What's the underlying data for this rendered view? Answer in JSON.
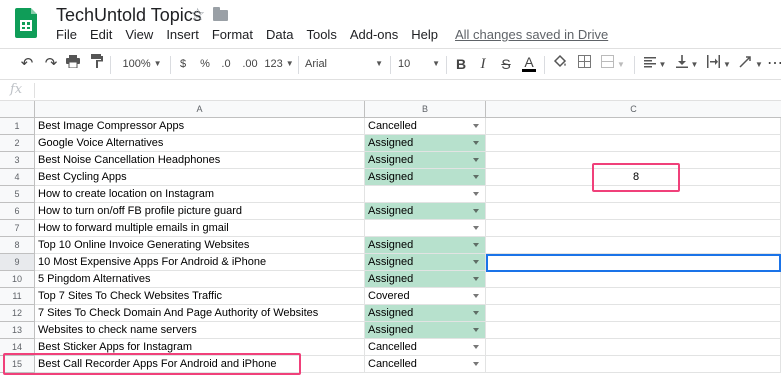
{
  "header": {
    "title": "TechUntold Topics",
    "menu": [
      "File",
      "Edit",
      "View",
      "Insert",
      "Format",
      "Data",
      "Tools",
      "Add-ons",
      "Help"
    ],
    "saved_status": "All changes saved in Drive"
  },
  "toolbar": {
    "zoom": "100%",
    "currency": "$",
    "percent": "%",
    "decimal_decrease": ".0",
    "decimal_increase": ".00",
    "more_formats": "123",
    "font": "Arial",
    "font_size": "10",
    "bold": "B",
    "italic": "I",
    "strikethrough": "S",
    "text_color": "A"
  },
  "formula_bar": {
    "fx": "fx",
    "value": ""
  },
  "columns": [
    "A",
    "B",
    "C"
  ],
  "rows": [
    {
      "num": "1",
      "a": "Best Image Compressor Apps",
      "b": "Cancelled"
    },
    {
      "num": "2",
      "a": "Google Voice Alternatives",
      "b": "Assigned"
    },
    {
      "num": "3",
      "a": "Best Noise Cancellation Headphones",
      "b": "Assigned"
    },
    {
      "num": "4",
      "a": "Best Cycling Apps",
      "b": "Assigned"
    },
    {
      "num": "5",
      "a": "How to create location on Instagram",
      "b": ""
    },
    {
      "num": "6",
      "a": "How to turn on/off FB profile picture guard",
      "b": "Assigned"
    },
    {
      "num": "7",
      "a": "How to forward multiple emails in gmail",
      "b": ""
    },
    {
      "num": "8",
      "a": "Top 10 Online Invoice Generating Websites",
      "b": "Assigned"
    },
    {
      "num": "9",
      "a": "10 Most Expensive Apps For Android & iPhone",
      "b": "Assigned"
    },
    {
      "num": "10",
      "a": "5 Pingdom Alternatives",
      "b": "Assigned"
    },
    {
      "num": "11",
      "a": "Top 7 Sites To Check Websites Traffic",
      "b": "Covered"
    },
    {
      "num": "12",
      "a": "7 Sites To Check Domain And Page Authority of Websites",
      "b": "Assigned"
    },
    {
      "num": "13",
      "a": "Websites to check name servers",
      "b": "Assigned"
    },
    {
      "num": "14",
      "a": "Best Sticker Apps for Instagram",
      "b": "Cancelled"
    },
    {
      "num": "15",
      "a": "Best Call Recorder Apps For Android and iPhone",
      "b": "Cancelled"
    }
  ],
  "c4_value": "8",
  "colors": {
    "assigned_fill": "#b7e1cd",
    "highlight_border": "#f0407a",
    "selection_border": "#1a73e8",
    "brand": "#0f9d58"
  }
}
